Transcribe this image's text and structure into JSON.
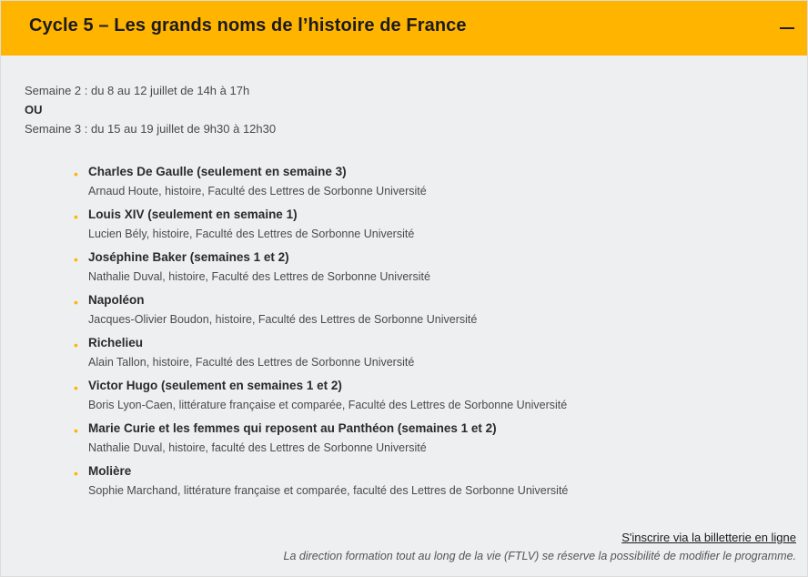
{
  "header": {
    "title": "Cycle 5 – Les grands noms de l’histoire de France"
  },
  "schedule": {
    "week2": "Semaine 2 : du 8 au 12 juillet de 14h à 17h",
    "or": "OU",
    "week3": "Semaine 3 : du 15 au 19 juillet de 9h30 à 12h30"
  },
  "items": [
    {
      "title": "Charles De Gaulle (seulement en semaine 3)",
      "author": "Arnaud Houte, histoire, Faculté des Lettres de Sorbonne Université"
    },
    {
      "title": "Louis XIV (seulement en semaine 1)",
      "author": "Lucien Bély, histoire, Faculté des Lettres de Sorbonne Université"
    },
    {
      "title": "Joséphine Baker (semaines 1 et 2)",
      "author": "Nathalie Duval, histoire, Faculté des Lettres de Sorbonne Université"
    },
    {
      "title": "Napoléon",
      "author": "Jacques-Olivier Boudon, histoire, Faculté des Lettres de Sorbonne Université"
    },
    {
      "title": "Richelieu",
      "author": "Alain Tallon, histoire, Faculté des Lettres de Sorbonne Université"
    },
    {
      "title": "Victor Hugo (seulement en semaines 1 et 2)",
      "author": "Boris Lyon-Caen, littérature française et comparée, Faculté des Lettres de Sorbonne Université"
    },
    {
      "title": "Marie Curie et les femmes qui reposent au Panthéon (semaines 1 et 2)",
      "author": "Nathalie Duval, histoire, faculté des Lettres de Sorbonne Université"
    },
    {
      "title": "Molière",
      "author": "Sophie Marchand, littérature française et comparée, faculté des Lettres de Sorbonne Université"
    }
  ],
  "footer": {
    "link": "S'inscrire via la billetterie en ligne",
    "disclaimer": "La direction formation tout au long de la vie (FTLV) se réserve la possibilité de modifier le programme."
  },
  "colors": {
    "accent": "#ffb400",
    "panel_bg": "#eeeff1",
    "text": "#2a2a2a"
  },
  "icons": {
    "collapse": "minus-icon",
    "bullet": "bullet-dot"
  }
}
